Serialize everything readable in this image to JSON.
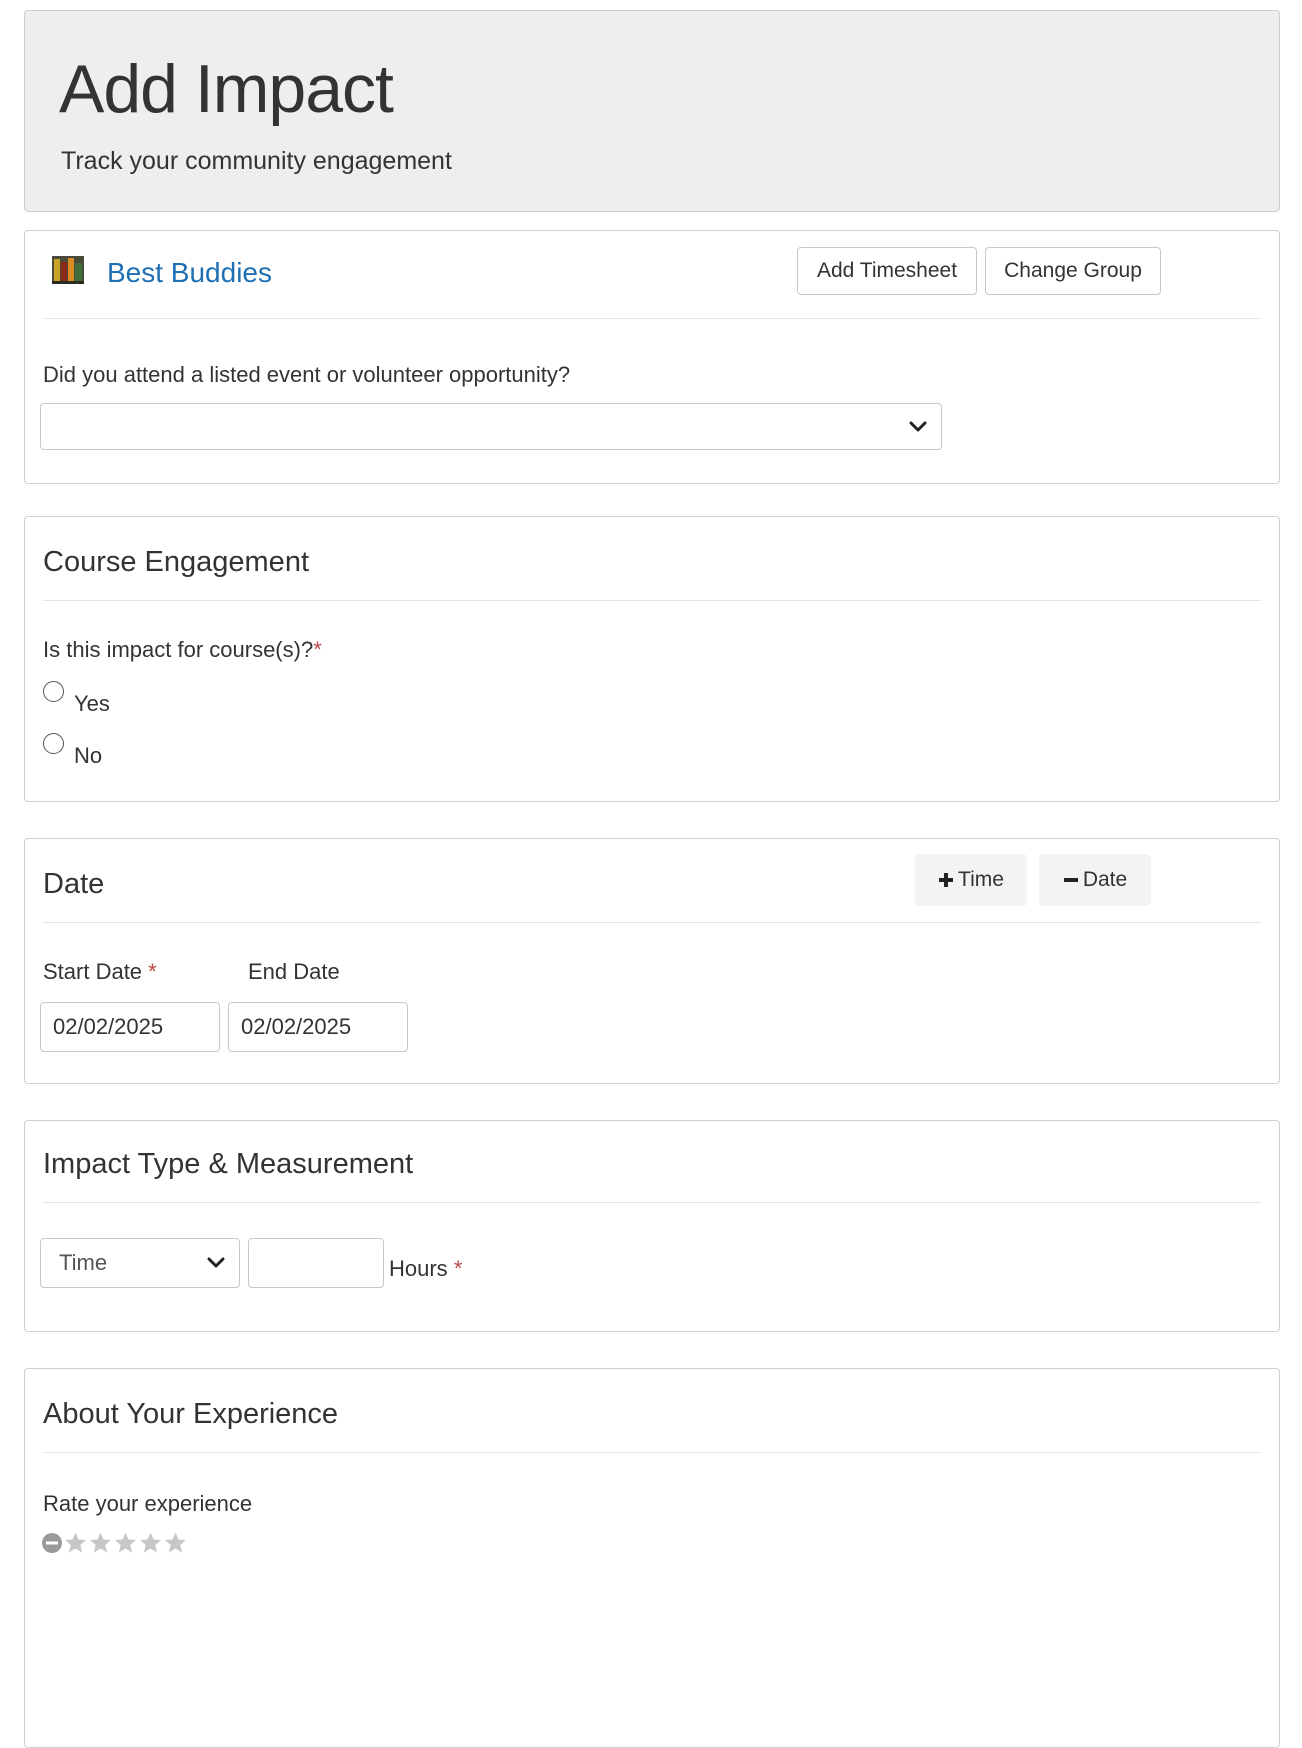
{
  "header": {
    "title": "Add Impact",
    "subtitle": "Track your community engagement"
  },
  "group": {
    "name": "Best Buddies",
    "add_timesheet_label": "Add Timesheet",
    "change_group_label": "Change Group",
    "event_question": "Did you attend a listed event or volunteer opportunity?",
    "event_select_value": ""
  },
  "course": {
    "title": "Course Engagement",
    "question": "Is this impact for course(s)?",
    "required_mark": "*",
    "options": [
      {
        "label": "Yes",
        "checked": false
      },
      {
        "label": "No",
        "checked": false
      }
    ]
  },
  "date": {
    "title": "Date",
    "add_time_label": "Time",
    "remove_date_label": "Date",
    "start_label": "Start Date",
    "end_label": "End Date",
    "required_mark": "*",
    "start_value": "02/02/2025",
    "end_value": "02/02/2025"
  },
  "impact": {
    "title": "Impact Type & Measurement",
    "type_value": "Time",
    "amount_value": "",
    "unit_label": "Hours",
    "required_mark": "*"
  },
  "experience": {
    "title": "About Your Experience",
    "rate_label": "Rate your experience",
    "rating": 0,
    "max_rating": 5
  },
  "colors": {
    "link": "#1f6fb2",
    "required": "#b94a48",
    "jumbotron_bg": "#eeeeee",
    "border": "#cfcfcf",
    "star_inactive": "#c7c7c7"
  }
}
